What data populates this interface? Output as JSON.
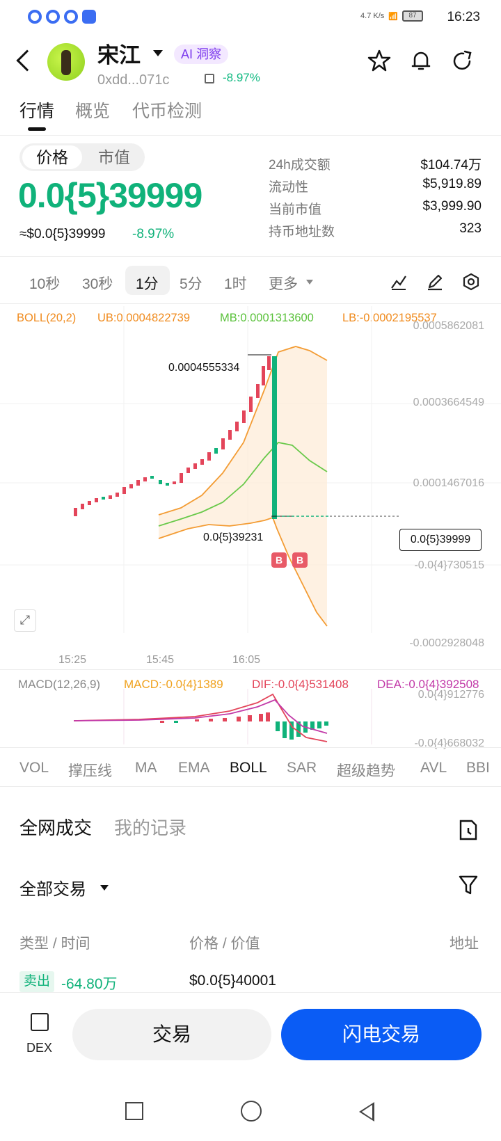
{
  "status_bar": {
    "time": "16:23",
    "net_speed": "4.7 K/s",
    "battery": "87"
  },
  "header": {
    "token_name": "宋江",
    "ai_badge": "AI 洞察",
    "address": "0xdd...071c",
    "change": "-8.97%",
    "icons": [
      "back-icon",
      "star-icon",
      "bell-icon",
      "share-icon"
    ]
  },
  "tabs": [
    "行情",
    "概览",
    "代币检测"
  ],
  "price": {
    "toggle": [
      "价格",
      "市值"
    ],
    "main": "0.0{5}39999",
    "usd": "≈$0.0{5}39999",
    "change": "-8.97%"
  },
  "stats": [
    {
      "label": "24h成交额",
      "value": "$104.74万"
    },
    {
      "label": "流动性",
      "value": "$5,919.89"
    },
    {
      "label": "当前市值",
      "value": "$3,999.90"
    },
    {
      "label": "持币地址数",
      "value": "323"
    }
  ],
  "intervals": [
    "10秒",
    "30秒",
    "1分",
    "5分",
    "1时",
    "更多"
  ],
  "selected_interval": "1分",
  "chart": {
    "boll": {
      "label": "BOLL(20,2)",
      "ub": "UB:0.0004822739",
      "mb": "MB:0.0001313600",
      "lb": "LB:-0.0002195537"
    },
    "y_ticks": [
      "0.0005862081",
      "0.0003664549",
      "0.0001467016",
      "-0.0{4}730515",
      "-0.0002928048"
    ],
    "x_ticks": [
      "15:25",
      "15:45",
      "16:05"
    ],
    "high_label": "0.0004555334",
    "low_label": "0.0{5}39231",
    "current_price_tag": "0.0{5}39999",
    "buy_marker": "B",
    "macd": {
      "label": "MACD(12,26,9)",
      "macd": "MACD:-0.0{4}1389",
      "dif": "DIF:-0.0{4}531408",
      "dea": "DEA:-0.0{4}392508",
      "y_top": "0.0{4}912776",
      "y_bottom": "-0.0{4}668032"
    },
    "colors": {
      "up": "#10b27a",
      "down": "#e3455a",
      "ub": "#f39c34",
      "mb": "#69c94a",
      "dea": "#c23aa8"
    }
  },
  "indicators": [
    "VOL",
    "撑压线",
    "MA",
    "EMA",
    "BOLL",
    "SAR",
    "超级趋势",
    "AVL",
    "BBI"
  ],
  "selected_indicator": "BOLL",
  "trades": {
    "tabs": [
      "全网成交",
      "我的记录"
    ],
    "filter": "全部交易",
    "columns": [
      "类型 / 时间",
      "价格 / 价值",
      "地址"
    ],
    "rows": [
      {
        "type": "卖出",
        "amount": "-64.80万",
        "price": "$0.0{5}40001"
      }
    ]
  },
  "bottom": {
    "dex": "DEX",
    "trade": "交易",
    "flash": "闪电交易"
  }
}
